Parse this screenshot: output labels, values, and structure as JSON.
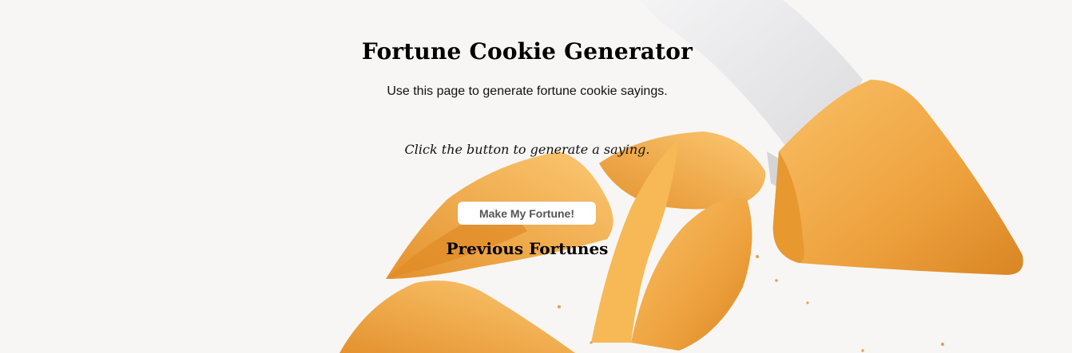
{
  "page": {
    "title": "Fortune Cookie Generator",
    "subtitle": "Use this page to generate fortune cookie sayings.",
    "prompt": "Click the button to generate a saying.",
    "button_label": "Make My Fortune!",
    "previous_heading": "Previous Fortunes"
  },
  "colors": {
    "background": "#f7f6f4",
    "cookie_light": "#f2b24a",
    "cookie_dark": "#e2902a",
    "paper_slip": "#ececee"
  }
}
